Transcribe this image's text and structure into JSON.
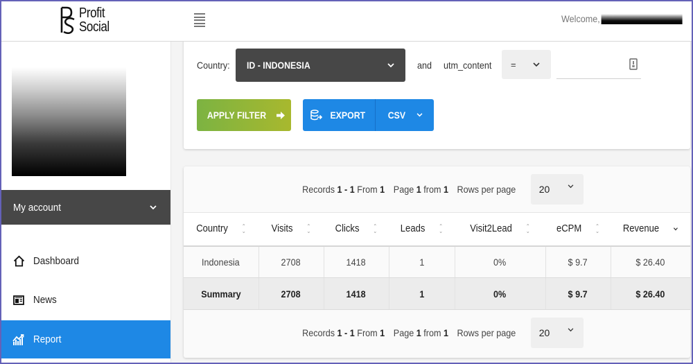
{
  "header": {
    "logo_line1": "Profit",
    "logo_line2": "Social",
    "welcome": "Welcome,"
  },
  "sidebar": {
    "account_label": "My account",
    "items": [
      {
        "label": "Dashboard",
        "icon": "home-icon",
        "active": false
      },
      {
        "label": "News",
        "icon": "newspaper-icon",
        "active": false
      },
      {
        "label": "Report",
        "icon": "chart-icon",
        "active": true
      }
    ]
  },
  "filter": {
    "country_label": "Country:",
    "country_value": "ID - INDONESIA",
    "and_label": "and",
    "field_label": "utm_content",
    "operator_value": "=",
    "utm_value": "",
    "apply_label": "APPLY FILTER",
    "export_label": "EXPORT",
    "format_value": "CSV"
  },
  "colors": {
    "accent_blue": "#1e88e5",
    "apply_green": "#8bb53a",
    "dark_select": "#474747"
  },
  "pager": {
    "records_prefix": "Records",
    "records_range": "1 - 1",
    "records_from": "From",
    "records_total": "1",
    "page_prefix": "Page",
    "page_current": "1",
    "page_from": "from",
    "page_total": "1",
    "rows_label": "Rows per page",
    "rows_value": "20"
  },
  "table": {
    "columns": [
      "Country",
      "Visits",
      "Clicks",
      "Leads",
      "Visit2Lead",
      "eCPM",
      "Revenue"
    ],
    "rows": [
      [
        "Indonesia",
        "2708",
        "1418",
        "1",
        "0%",
        "$ 9.7",
        "$ 26.40"
      ]
    ],
    "summary": [
      "Summary",
      "2708",
      "1418",
      "1",
      "0%",
      "$ 9.7",
      "$ 26.40"
    ]
  }
}
